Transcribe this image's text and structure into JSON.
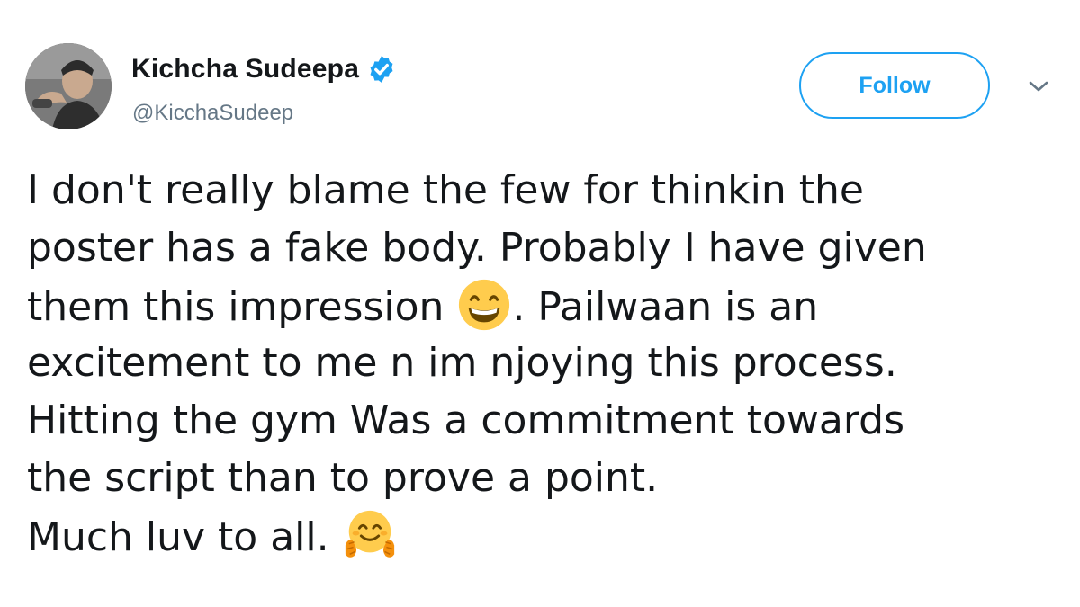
{
  "tweet": {
    "author": {
      "display_name": "Kichcha Sudeepa",
      "handle": "@KicchaSudeep",
      "verified": true,
      "avatar_icon": "profile-photo"
    },
    "follow_label": "Follow",
    "menu_icon": "chevron-down-icon",
    "text_lines": [
      "I don't really blame the few for thinkin the",
      "poster has a fake body. Probably I have given",
      "them this impression ",
      ". Pailwaan is an",
      "excitement to me n im njoying this process.",
      "Hitting the gym Was a commitment towards",
      "the script than to prove a point.",
      "Much luv to all. "
    ],
    "emojis": [
      "grinning-face-icon",
      "hugging-face-icon"
    ]
  },
  "colors": {
    "accent": "#1da1f2",
    "text": "#14171a",
    "secondary_text": "#657786"
  }
}
